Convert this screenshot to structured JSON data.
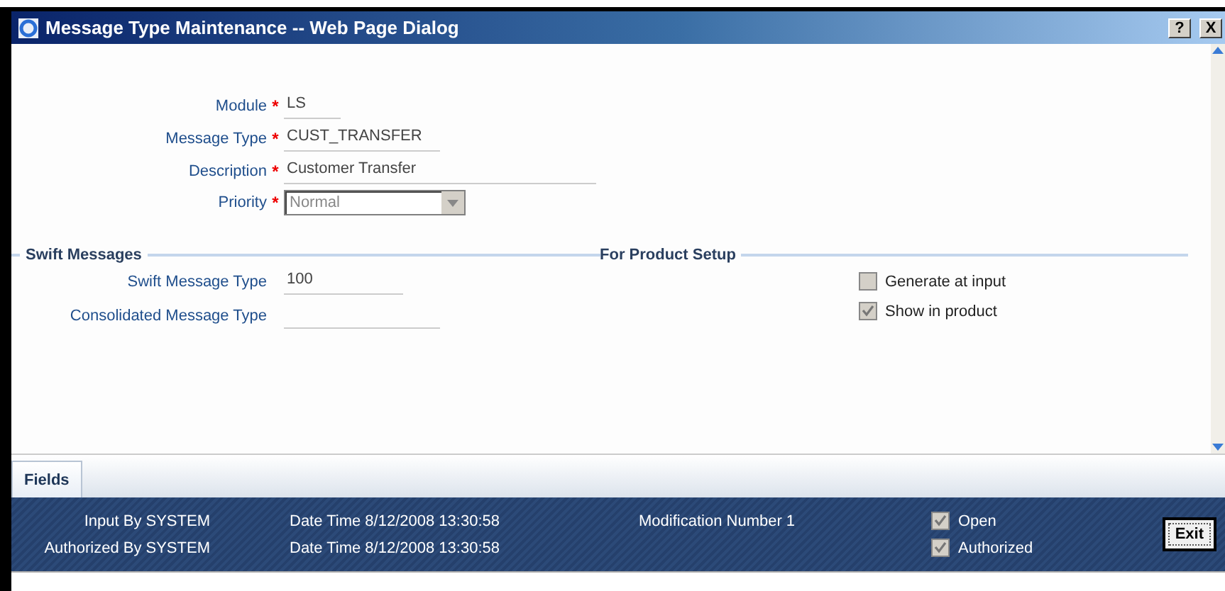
{
  "window": {
    "title": "Message Type Maintenance -- Web Page Dialog",
    "buttons": [
      "?",
      "X"
    ]
  },
  "fields": [
    {
      "label": "Module",
      "required_mark": "*",
      "kind": "text",
      "value": "LS"
    },
    {
      "label": "Message Type",
      "required_mark": "*",
      "kind": "text",
      "value": "CUST_TRANSFER"
    },
    {
      "label": "Description",
      "required_mark": "*",
      "kind": "text",
      "value": "Customer Transfer"
    },
    {
      "label": "Priority",
      "required_mark": "*",
      "kind": "select",
      "value": "Normal"
    }
  ],
  "swift_messages": {
    "title": "Swift Messages",
    "fields": [
      {
        "label": "Swift Message Type",
        "value": "100"
      },
      {
        "label": "Consolidated Message Type"
      }
    ]
  },
  "product_setup": {
    "title": "For Product Setup",
    "options": [
      {
        "label": "Generate at input",
        "checked": false
      },
      {
        "label": "Show in product",
        "checked": true
      }
    ]
  },
  "tabs": [
    {
      "label": "Fields",
      "selected": true
    }
  ],
  "footer": {
    "rows": [
      {
        "by": "Input By SYSTEM",
        "date": "Date Time 8/12/2008 13:30:58",
        "extra": "Modification Number 1",
        "check": {
          "label": "Open",
          "checked": true
        }
      },
      {
        "by": "Authorized By SYSTEM",
        "date": "Date Time 8/12/2008 13:30:58",
        "check": {
          "label": "Authorized",
          "checked": true
        }
      }
    ],
    "exit": "Exit"
  }
}
